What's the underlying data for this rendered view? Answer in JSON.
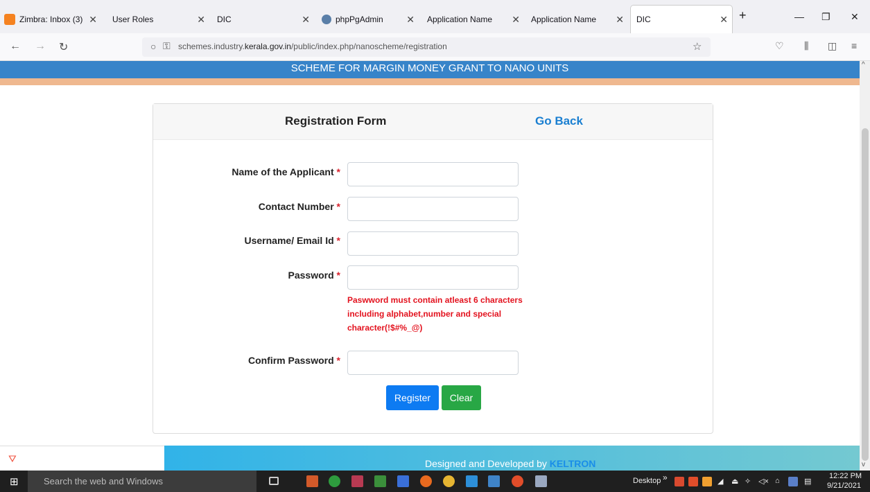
{
  "browser": {
    "tabs": [
      {
        "label": "Zimbra: Inbox (3)",
        "icon": "zimbra-icon",
        "color": "#f58220"
      },
      {
        "label": "User Roles",
        "icon": "",
        "color": ""
      },
      {
        "label": "DIC",
        "icon": "",
        "color": ""
      },
      {
        "label": "phpPgAdmin",
        "icon": "elephant-icon",
        "color": "#5a7fa8"
      },
      {
        "label": "Application Name",
        "icon": "",
        "color": ""
      },
      {
        "label": "Application Name",
        "icon": "",
        "color": ""
      },
      {
        "label": "DIC",
        "icon": "",
        "color": ""
      }
    ],
    "url_prefix": "schemes.industry.",
    "url_domain": "kerala.gov.in",
    "url_suffix": "/public/index.php/nanoscheme/registration"
  },
  "page": {
    "banner_title": "SCHEME FOR MARGIN MONEY GRANT TO NANO UNITS",
    "form_title": "Registration Form",
    "go_back": "Go Back",
    "required_mark": "*",
    "fields": [
      {
        "label": "Name of the Applicant",
        "value": ""
      },
      {
        "label": "Contact Number",
        "value": ""
      },
      {
        "label": "Username/ Email Id",
        "value": ""
      },
      {
        "label": "Password",
        "value": ""
      },
      {
        "label": "Confirm Password",
        "value": ""
      }
    ],
    "password_hint": "Paswword must contain atleast 6 characters including alphabet,number and special character(!$#%_@)",
    "register_label": "Register",
    "clear_label": "Clear",
    "footer_prefix": "Designed and Developed by",
    "footer_brand": "KELTRON"
  },
  "taskbar": {
    "search_placeholder": "Search the web and Windows",
    "desktop_label": "Desktop",
    "time": "12:22 PM",
    "date": "9/21/2021"
  },
  "colors": {
    "banner_blue": "#3784c9",
    "banner_orange": "#efb88f",
    "link_blue": "#1a7fd1",
    "required_red": "#d9232e",
    "register_blue": "#0d7bf2",
    "clear_green": "#28a745"
  }
}
